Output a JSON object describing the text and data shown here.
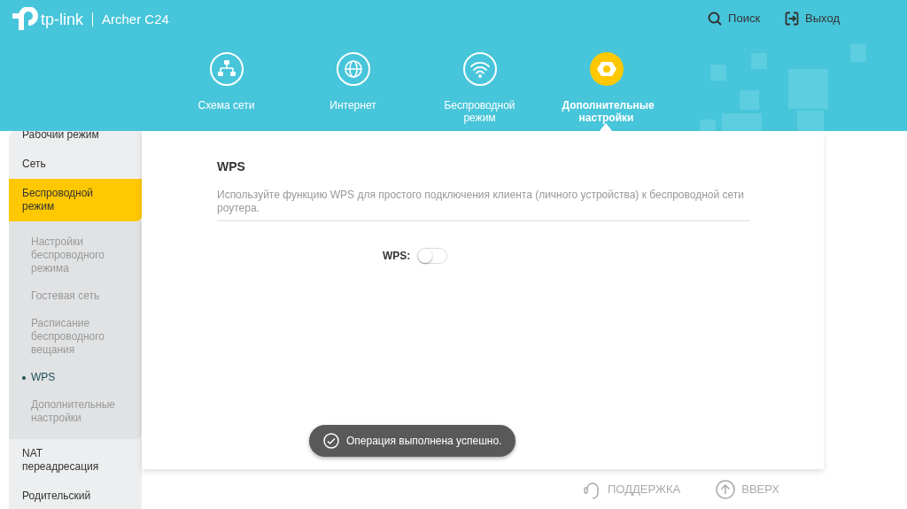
{
  "header": {
    "brand": "tp-link",
    "model": "Archer C24",
    "actions": [
      {
        "kind": "search",
        "label": "Поиск"
      },
      {
        "kind": "logout",
        "label": "Выход"
      }
    ]
  },
  "tabs": [
    {
      "kind": "network",
      "label": "Схема сети",
      "selected": false
    },
    {
      "kind": "internet",
      "label": "Интернет",
      "selected": false
    },
    {
      "kind": "wireless",
      "label": "Беспроводной режим",
      "selected": false
    },
    {
      "kind": "advanced",
      "label": "Дополнительные настройки",
      "selected": true
    }
  ],
  "sidebar": {
    "items": [
      {
        "label": "Рабочий режим",
        "selected": false
      },
      {
        "label": "Сеть",
        "selected": false
      },
      {
        "label": "Беспроводной режим",
        "selected": true,
        "expanded": true,
        "children": [
          {
            "label": "Настройки беспроводного режима",
            "selected": false
          },
          {
            "label": "Гостевая сеть",
            "selected": false
          },
          {
            "label": "Расписание беспроводного вещания",
            "selected": false
          },
          {
            "label": "WPS",
            "selected": true
          },
          {
            "label": "Дополнительные настройки",
            "selected": false
          }
        ]
      },
      {
        "label": "NAT переадресация",
        "selected": false
      },
      {
        "label": "Родительский",
        "selected": false
      }
    ]
  },
  "section": {
    "title": "WPS",
    "description": "Используйте функцию WPS для простого подключения клиента (личного устройства) к беспроводной сети роутера.",
    "toggle": {
      "label": "WPS",
      "separator": ":",
      "on": false
    }
  },
  "toast": {
    "message": "Операция выполнена успешно."
  },
  "footer": {
    "links": [
      {
        "kind": "support",
        "label": "ПОДДЕРЖКА"
      },
      {
        "kind": "top",
        "label": "ВВЕРХ"
      }
    ]
  }
}
